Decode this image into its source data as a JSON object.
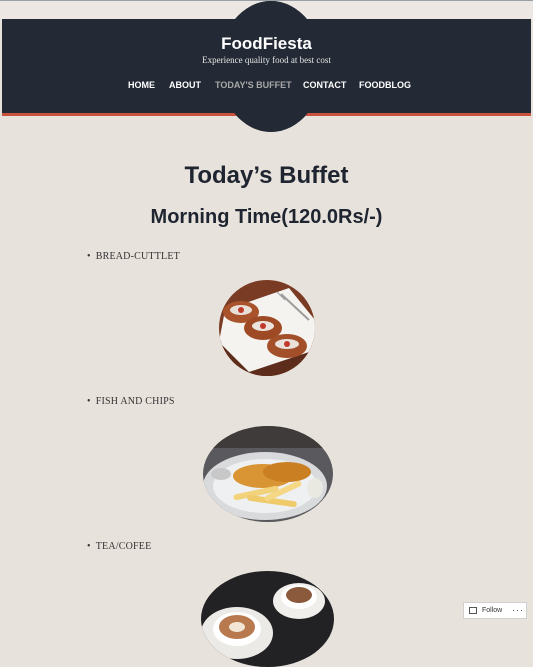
{
  "site": {
    "title": "FoodFiesta",
    "tagline": "Experience quality food at best cost"
  },
  "nav": {
    "items": [
      {
        "label": "HOME"
      },
      {
        "label": "ABOUT"
      },
      {
        "label": "TODAY'S BUFFET",
        "active": true
      },
      {
        "label": "CONTACT"
      },
      {
        "label": "FOODBLOG"
      }
    ]
  },
  "main": {
    "page_title": "Today’s Buffet",
    "section_title": "Morning Time(120.0Rs/-)",
    "items": [
      {
        "label": "BREAD-CUTTLET",
        "image_icon": "cutlet-plate-icon"
      },
      {
        "label": "FISH AND CHIPS",
        "image_icon": "fish-and-chips-icon"
      },
      {
        "label": "TEA/COFEE",
        "image_icon": "coffee-cups-icon"
      }
    ]
  },
  "follow_widget": {
    "label": "Follow",
    "more": "···"
  },
  "colors": {
    "header_bg": "#232a35",
    "accent_border": "#c8523b",
    "page_bg": "#e8e2dc",
    "text_dark": "#1f2530"
  }
}
